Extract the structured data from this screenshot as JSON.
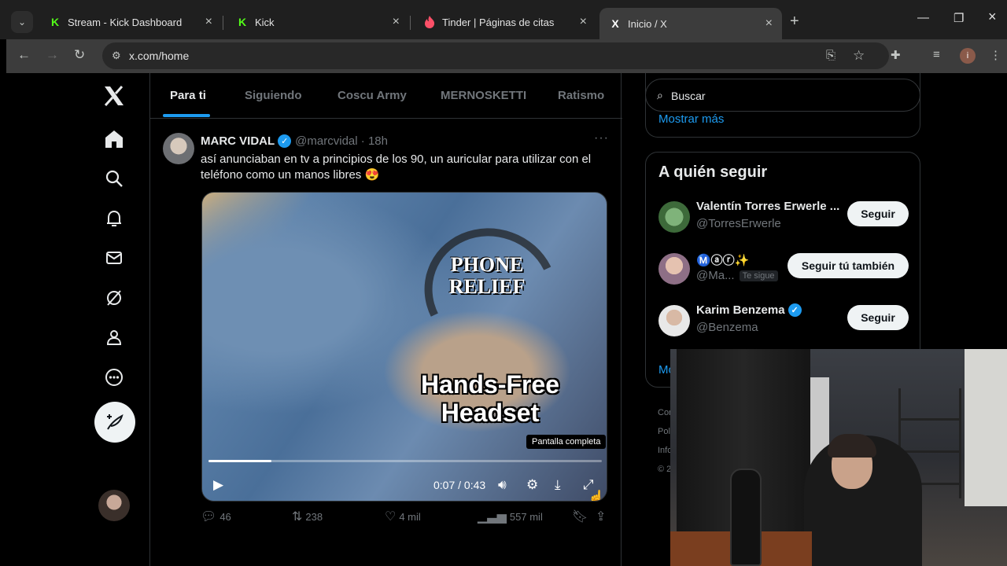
{
  "browser": {
    "tabs": [
      {
        "title": "Stream - Kick Dashboard",
        "favicon": "K",
        "active": false
      },
      {
        "title": "Kick",
        "favicon": "K",
        "active": false
      },
      {
        "title": "Tinder | Páginas de citas",
        "favicon": "flame",
        "active": false
      },
      {
        "title": "Inicio / X",
        "favicon": "X",
        "active": true
      }
    ],
    "url": "x.com/home",
    "profile_initial": "i",
    "colors": {
      "kick_green": "#53fc18",
      "tinder_pink": "#fd5068"
    }
  },
  "x": {
    "timeline_tabs": [
      "Para ti",
      "Siguiendo",
      "Coscu Army",
      "MERNOSKETTI",
      "Ratismo"
    ],
    "tweet": {
      "name": "MARC VIDAL",
      "handle": "@marcvidal",
      "time": "18h",
      "text": "así anunciaban en tv a principios de los 90, un auricular para utilizar con el teléfono como un manos libres 😍",
      "video": {
        "logo_text": "PHONE RELIEF",
        "caption": "Hands-Free Headset",
        "tooltip": "Pantalla completa",
        "timecode": "0:07 / 0:43",
        "progress": 0.16
      },
      "stats": {
        "replies": "46",
        "reposts": "238",
        "likes": "4 mil",
        "views": "557 mil"
      }
    },
    "search_placeholder": "Buscar",
    "show_more": "Mostrar más",
    "who_to_follow": {
      "title": "A quién seguir",
      "users": [
        {
          "name": "Valentín Torres Erwerle ...",
          "handle": "@TorresErwerle",
          "button": "Seguir",
          "verified": false,
          "follows_you": ""
        },
        {
          "name": "Ⓜ️ⓐⓡ✨",
          "handle": "@Ma...",
          "button": "Seguir tú también",
          "verified": false,
          "follows_you": "Te sigue"
        },
        {
          "name": "Karim Benzema",
          "handle": "@Benzema",
          "button": "Seguir",
          "verified": true,
          "follows_you": ""
        }
      ],
      "show_more": "Mo"
    },
    "footer_partial": [
      "Cor",
      "Pol",
      "Info",
      "© 2"
    ],
    "accent": "#1d9bf0"
  }
}
